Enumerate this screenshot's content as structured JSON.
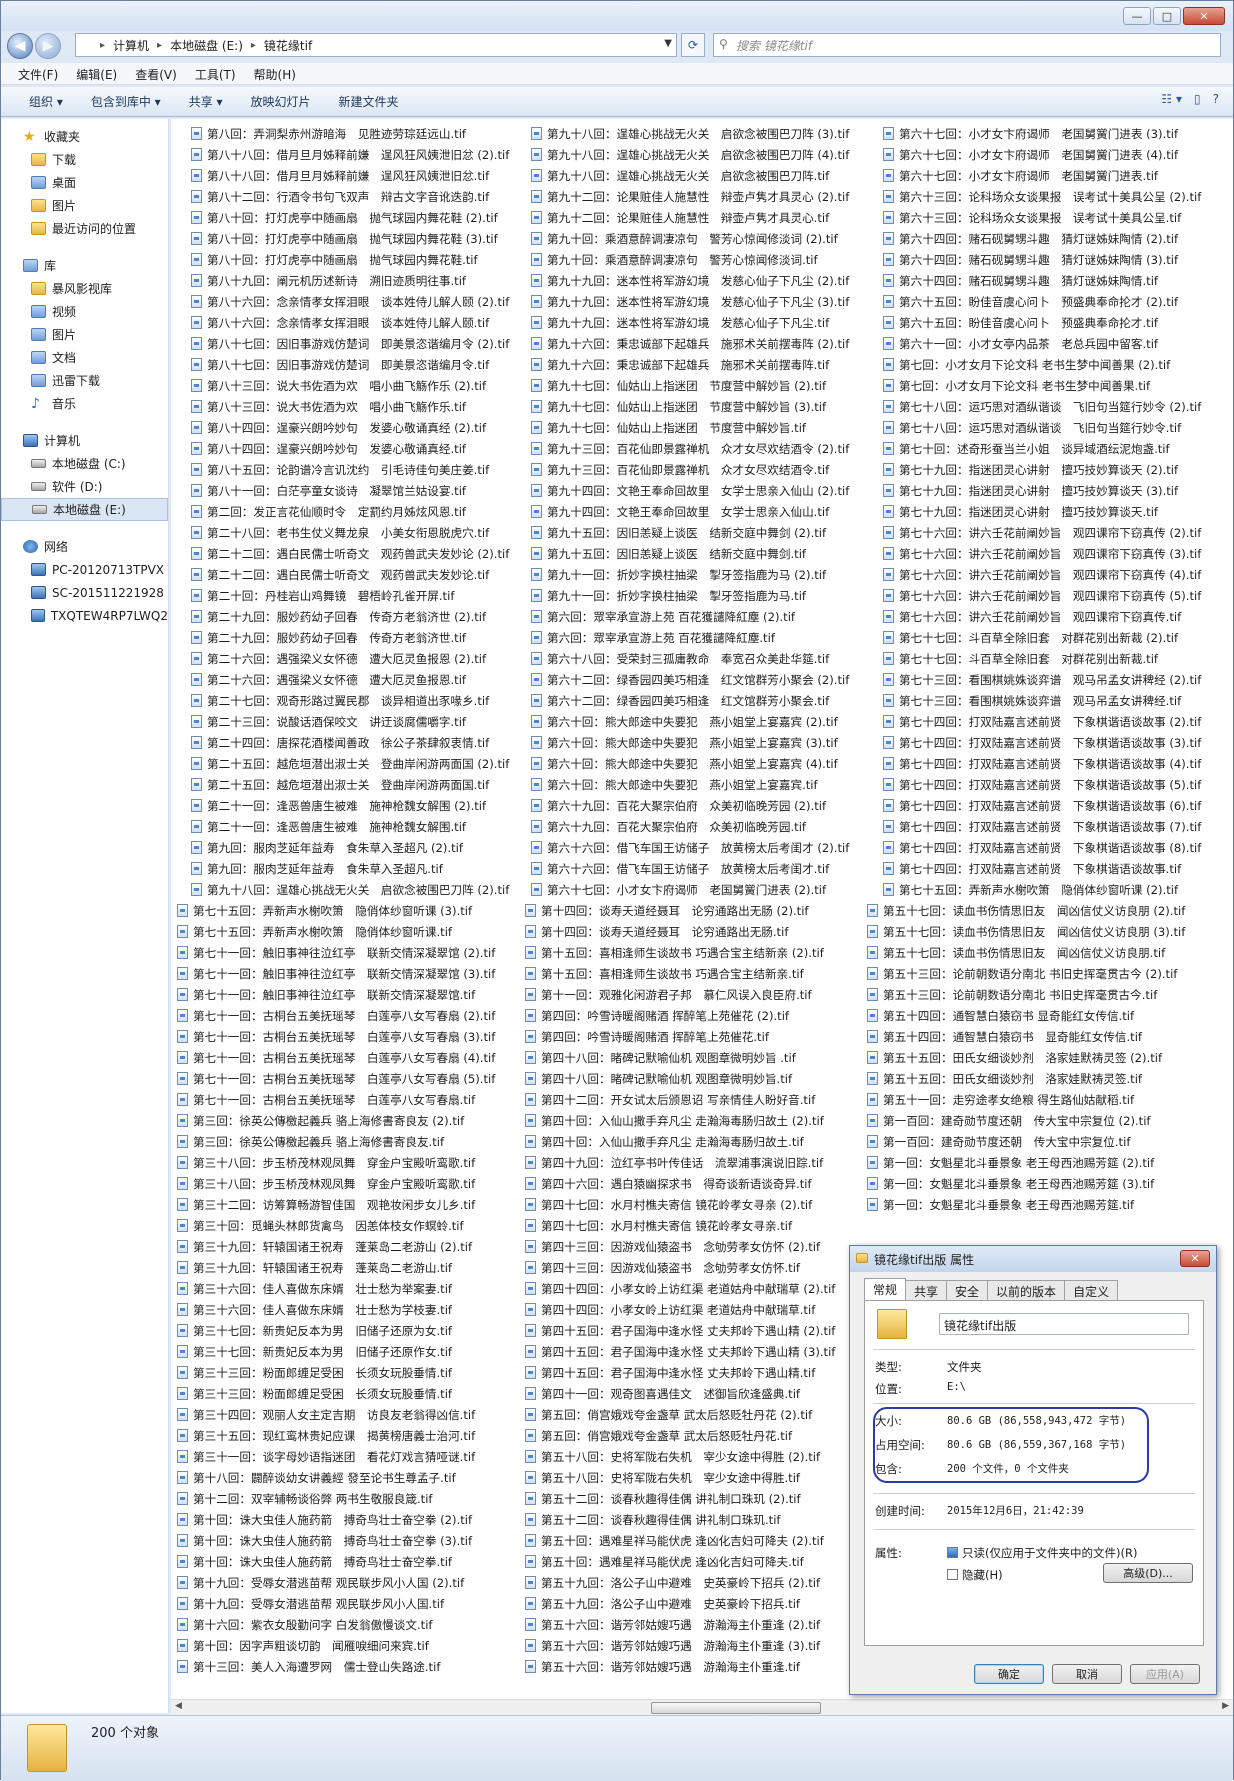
{
  "window": {
    "buttons": [
      "—",
      "□",
      "✕"
    ]
  },
  "nav": {
    "back": "◀",
    "forward": "▶",
    "path": [
      "计算机",
      "本地磁盘 (E:)",
      "镜花缘tif"
    ],
    "search_placeholder": "搜索 镜花缘tif"
  },
  "menu": [
    "文件(F)",
    "编辑(E)",
    "查看(V)",
    "工具(T)",
    "帮助(H)"
  ],
  "toolbar": [
    "组织 ▾",
    "包含到库中 ▾",
    "共享 ▾",
    "放映幻灯片",
    "新建文件夹"
  ],
  "sidebar": [
    {
      "label": "收藏夹",
      "icon": "star-icon",
      "hd": true,
      "gap": false
    },
    {
      "label": "下载",
      "icon": "folder-icon"
    },
    {
      "label": "桌面",
      "icon": "desktop-icon"
    },
    {
      "label": "图片",
      "icon": "folder-icon"
    },
    {
      "label": "最近访问的位置",
      "icon": "folder-icon"
    },
    {
      "label": "库",
      "icon": "library-icon",
      "hd": true,
      "gap": true
    },
    {
      "label": "暴风影视库",
      "icon": "folder-icon"
    },
    {
      "label": "视频",
      "icon": "library-icon"
    },
    {
      "label": "图片",
      "icon": "library-icon"
    },
    {
      "label": "文档",
      "icon": "library-icon"
    },
    {
      "label": "迅雷下载",
      "icon": "library-icon"
    },
    {
      "label": "音乐",
      "icon": "music-icon"
    },
    {
      "label": "计算机",
      "icon": "computer-icon",
      "hd": true,
      "gap": true
    },
    {
      "label": "本地磁盘 (C:)",
      "icon": "disk-icon"
    },
    {
      "label": "软件 (D:)",
      "icon": "disk-icon"
    },
    {
      "label": "本地磁盘 (E:)",
      "icon": "disk-icon",
      "sel": true
    },
    {
      "label": "网络",
      "icon": "network-icon",
      "hd": true,
      "gap": true
    },
    {
      "label": "PC-20120713TPVX",
      "icon": "computer-icon"
    },
    {
      "label": "SC-201511221928",
      "icon": "computer-icon"
    },
    {
      "label": "TXQTEW4RP7LWQ2",
      "icon": "computer-icon"
    }
  ],
  "columns": [
    [
      "第八回：弄洞梨赤州游暗海　见胜迹劳琮廷远山.tif",
      "第八十八回：借月旦月姊释前嫌　逞风狂风姨泄旧忿 (2).tif",
      "第八十八回：借月旦月姊释前嫌　逞风狂风姨泄旧忿.tif",
      "第八十二回：行酒令书句飞双声　辩古文字音讹迭韵.tif",
      "第八十回：打灯虎亭中随画扇　抛气球园内舞花鞋 (2).tif",
      "第八十回：打灯虎亭中随画扇　抛气球园内舞花鞋 (3).tif",
      "第八十回：打灯虎亭中随画扇　抛气球园内舞花鞋.tif",
      "第八十九回：阐元机历述新诗　溯旧迹质明往事.tif",
      "第八十六回：念亲情孝女挥泪眼　谈本姓侍儿解人颐 (2).tif",
      "第八十六回：念亲情孝女挥泪眼　谈本姓侍儿解人颐.tif",
      "第八十七回：因旧事游戏仿楚词　即美景恣谐编月令 (2).tif",
      "第八十七回：因旧事游戏仿楚词　即美景恣谐编月令.tif",
      "第八十三回：说大书佐酒为欢　唱小曲飞觞作乐 (2).tif",
      "第八十三回：说大书佐酒为欢　唱小曲飞觞作乐.tif",
      "第八十四回：逞豪兴朗吟妙句　发婆心敬诵真经 (2).tif",
      "第八十四回：逞豪兴朗吟妙句　发婆心敬诵真经.tif",
      "第八十五回：论韵谱冷言讥沈约　引毛诗佳句美庄姜.tif",
      "第八十一回：白茫亭童女谈诗　凝翠馆兰姑设宴.tif",
      "第二回：发正言花仙顺时令　定罰约月姊炫风恩.tif",
      "第二十八回：老书生仗义舞龙泉　小美女衔恩脱虎穴.tif",
      "第二十二回：遇白民儒士听奇文　观药兽武夫发妙论 (2).tif",
      "第二十二回：遇白民儒士听奇文　观药兽武夫发妙论.tif",
      "第二十回：丹桂岩山鸡舞镜　碧梧岭孔雀开屏.tif",
      "第二十九回：服妙药幼子回春　传奇方老翁济世 (2).tif",
      "第二十九回：服妙药幼子回春　传奇方老翁济世.tif",
      "第二十六回：遇强梁义女怀德　遭大厄灵鱼报恩 (2).tif",
      "第二十六回：遇强梁义女怀德　遭大厄灵鱼报恩.tif",
      "第二十七回：观奇形路过翼民郡　谈异相道出豕喙乡.tif",
      "第二十三回：说酸话酒保咬文　讲迂谈腐儒嚼字.tif",
      "第二十四回：唐探花酒楼闻善政　徐公子茶肆叙衷情.tif",
      "第二十五回：越危垣潜出淑士关　登曲岸闲游两面国 (2).tif",
      "第二十五回：越危垣潜出淑士关　登曲岸闲游两面国.tif",
      "第二十一回：逢恶兽唐生被难　施神枪魏女解围 (2).tif",
      "第二十一回：逢恶兽唐生被难　施神枪魏女解围.tif",
      "第九回：服肉芝延年益寿　食朱草入圣超凡 (2).tif",
      "第九回：服肉芝延年益寿　食朱草入圣超凡.tif",
      "第九十八回：逞雄心挑战无火关　启欲念被围巴刀阵 (2).tif"
    ],
    [
      "第九十八回：逞雄心挑战无火关　启欲念被围巴刀阵 (3).tif",
      "第九十八回：逞雄心挑战无火关　启欲念被围巴刀阵 (4).tif",
      "第九十八回：逞雄心挑战无火关　启欲念被围巴刀阵.tif",
      "第九十二回：论果赃佳人施慧性　辩壶卢隽才具灵心 (2).tif",
      "第九十二回：论果赃佳人施慧性　辩壶卢隽才具灵心.tif",
      "第九十回：乘酒意醉调凄凉句　警芳心惊闻修淡词 (2).tif",
      "第九十回：乘酒意醉调凄凉句　警芳心惊闻修淡词.tif",
      "第九十九回：迷本性将军游幻境　发慈心仙子下凡尘 (2).tif",
      "第九十九回：迷本性将军游幻境　发慈心仙子下凡尘 (3).tif",
      "第九十九回：迷本性将军游幻境　发慈心仙子下凡尘.tif",
      "第九十六回：秉忠诚部下起雄兵　施邪术关前摆毒阵 (2).tif",
      "第九十六回：秉忠诚部下起雄兵　施邪术关前摆毒阵.tif",
      "第九十七回：仙姑山上指迷团　节度营中解妙旨 (2).tif",
      "第九十七回：仙姑山上指迷团　节度营中解妙旨 (3).tif",
      "第九十七回：仙姑山上指迷团　节度营中解妙旨.tif",
      "第九十三回：百花仙即景露禅机　众才女尽欢结酒令 (2).tif",
      "第九十三回：百花仙即景露禅机　众才女尽欢结酒令.tif",
      "第九十四回：文艳王奉命回故里　女学士思亲入仙山 (2).tif",
      "第九十四回：文艳王奉命回故里　女学士思亲入仙山.tif",
      "第九十五回：因旧恙疑上谈医　结新交庭中舞剑 (2).tif",
      "第九十五回：因旧恙疑上谈医　结新交庭中舞剑.tif",
      "第九十一回：折妙字换柱抽梁　掣牙签指鹿为马 (2).tif",
      "第九十一回：折妙字换柱抽梁　掣牙签指鹿为马.tif",
      "第六回：眾宰承宣游上苑 百花獲譴降紅塵 (2).tif",
      "第六回：眾宰承宣游上苑 百花獲譴降紅塵.tif",
      "第六十八回：受荣封三孤庸教命　奉宽召众美赴华筵.tif",
      "第六十二回：绿香园四美巧相逢　红文馆群芳小聚会 (2).tif",
      "第六十二回：绿香园四美巧相逢　红文馆群芳小聚会.tif",
      "第六十回：熊大郎途中失要犯　燕小姐堂上宴嘉宾 (2).tif",
      "第六十回：熊大郎途中失要犯　燕小姐堂上宴嘉宾 (3).tif",
      "第六十回：熊大郎途中失要犯　燕小姐堂上宴嘉宾 (4).tif",
      "第六十回：熊大郎途中失要犯　燕小姐堂上宴嘉宾.tif",
      "第六十九回：百花大聚宗伯府　众美初临晚芳园 (2).tif",
      "第六十九回：百花大聚宗伯府　众美初临晚芳园.tif",
      "第六十六回：借飞车国王访储子　放黄榜太后考闺才 (2).tif",
      "第六十六回：借飞车国王访储子　放黄榜太后考闺才.tif",
      "第六十七回：小才女卞府谒师　老国舅黉门进表 (2).tif"
    ],
    [
      "第六十七回：小才女卞府谒师　老国舅黉门进表 (3).tif",
      "第六十七回：小才女卞府谒师　老国舅黉门进表 (4).tif",
      "第六十七回：小才女卞府谒师　老国舅黉门进表.tif",
      "第六十三回：论科场众女谈果报　误考试十美具公呈 (2).tif",
      "第六十三回：论科场众女谈果报　误考试十美具公呈.tif",
      "第六十四回：赌石砚舅甥斗趣　猜灯谜姊妹陶情 (2).tif",
      "第六十四回：赌石砚舅甥斗趣　猜灯谜姊妹陶情 (3).tif",
      "第六十四回：赌石砚舅甥斗趣　猜灯谜姊妹陶情.tif",
      "第六十五回：盼佳音虞心问卜　预盛典奉命抡才 (2).tif",
      "第六十五回：盼佳音虞心问卜　预盛典奉命抡才.tif",
      "第六十一回：小才女亭内品茶　老总兵园中留客.tif",
      "第七回：小才女月下论文科 老书生梦中闻善果 (2).tif",
      "第七回：小才女月下论文科 老书生梦中闻善果.tif",
      "第七十八回：运巧思对酒纵谐谈　飞旧句当筵行妙令 (2).tif",
      "第七十八回：运巧思对酒纵谐谈　飞旧句当筵行妙令.tif",
      "第七十回：述奇形蚕当兰小姐　谈异域酒纭泥炮盏.tif",
      "第七十九回：指迷团灵心讲射　擅巧技妙算谈天 (2).tif",
      "第七十九回：指迷团灵心讲射　擅巧技妙算谈天 (3).tif",
      "第七十九回：指迷团灵心讲射　擅巧技妙算谈天.tif",
      "第七十六回：讲六壬花前阐妙旨　观四课帘下窃真传 (2).tif",
      "第七十六回：讲六壬花前阐妙旨　观四课帘下窃真传 (3).tif",
      "第七十六回：讲六壬花前阐妙旨　观四课帘下窃真传 (4).tif",
      "第七十六回：讲六壬花前阐妙旨　观四课帘下窃真传 (5).tif",
      "第七十六回：讲六壬花前阐妙旨　观四课帘下窃真传.tif",
      "第七十七回：斗百草全除旧套　对群花别出新裁 (2).tif",
      "第七十七回：斗百草全除旧套　对群花别出新裁.tif",
      "第七十三回：看围棋姚姝谈弈谱　观马吊孟女讲稗经 (2).tif",
      "第七十三回：看围棋姚姝谈弈谱　观马吊孟女讲稗经.tif",
      "第七十四回：打双陆嘉言述前贤　下象棋谐语谈故事 (2).tif",
      "第七十四回：打双陆嘉言述前贤　下象棋谐语谈故事 (3).tif",
      "第七十四回：打双陆嘉言述前贤　下象棋谐语谈故事 (4).tif",
      "第七十四回：打双陆嘉言述前贤　下象棋谐语谈故事 (5).tif",
      "第七十四回：打双陆嘉言述前贤　下象棋谐语谈故事 (6).tif",
      "第七十四回：打双陆嘉言述前贤　下象棋谐语谈故事 (7).tif",
      "第七十四回：打双陆嘉言述前贤　下象棋谐语谈故事 (8).tif",
      "第七十四回：打双陆嘉言述前贤　下象棋谐语谈故事.tif",
      "第七十五回：弄新声水榭吹箫　隐俏体纱窗听课 (2).tif"
    ],
    [
      "第七十五回：弄新声水榭吹箫　隐俏体纱窗听课 (3).tif",
      "第七十五回：弄新声水榭吹箫　隐俏体纱窗听课.tif",
      "第七十一回：触旧事神往泣红亭　联新交情深凝翠馆 (2).tif",
      "第七十一回：触旧事神往泣红亭　联新交情深凝翠馆 (3).tif",
      "第七十一回：触旧事神往泣红亭　联新交情深凝翠馆.tif",
      "第七十一回：古桐台五美抚瑶琴　白莲亭八女写春扇 (2).tif",
      "第七十一回：古桐台五美抚瑶琴　白莲亭八女写春扇 (3).tif",
      "第七十一回：古桐台五美抚瑶琴　白莲亭八女写春扇 (4).tif",
      "第七十一回：古桐台五美抚瑶琴　白莲亭八女写春扇 (5).tif",
      "第七十一回：古桐台五美抚瑶琴　白莲亭八女写春扇.tif",
      "第三回：徐英公傳檄起義兵 骆上海修書寄良友 (2).tif",
      "第三回：徐英公傳檄起義兵 骆上海修書寄良友.tif",
      "第三十八回：步玉桥茂林观凤舞　穿金户宝殿听鸾歌.tif",
      "第三十八回：步玉桥茂林观凤舞　穿金户宝殿听鸾歌.tif",
      "第三十二回：访筹算畅游智佳国　观艳妆闲步女儿乡.tif",
      "第三十回：觅蝇头林郎货禽鸟　因恙体枝女作螟蛉.tif",
      "第三十九回：轩辕国诸王祝寿　蓬莱岛二老游山 (2).tif",
      "第三十九回：轩辕国诸王祝寿　蓬莱岛二老游山.tif",
      "第三十六回：佳人喜做东床婿　壮士愁为举案妻.tif",
      "第三十六回：佳人喜做东床婿　壮士愁为学枝妻.tif",
      "第三十七回：新贵妃反本为男　旧储子还原为女.tif",
      "第三十七回：新贵妃反本为男　旧储子还原作女.tif",
      "第三十三回：粉面郎缠足受困　长须女玩股垂情.tif",
      "第三十三回：粉面郎缠足受困　长须女玩股垂情.tif",
      "第三十四回：观丽人女主定吉期　访良友老翁得凶信.tif",
      "第三十五回：现红鸾林贵妃应课　揭黄榜唐義士治河.tif",
      "第三十一回：谈字母妙语指迷团　看花灯戏言猜哑谜.tif",
      "第十八回：闢醉谈幼女讲義經 發至论书生尊孟子.tif",
      "第十二回：双宰辅畅谈俗弊 两书生敬服良箴.tif",
      "第十回：诛大虫佳人施药箭　搏奇鸟壮士奋空拳 (2).tif",
      "第十回：诛大虫佳人施药箭　搏奇鸟壮士奋空拳 (3).tif",
      "第十回：诛大虫佳人施药箭　搏奇鸟壮士奋空拳.tif",
      "第十九回：受辱女潜逃苗帮 观民联步风小人国 (2).tif",
      "第十九回：受辱女潜逃苗帮 观民联步风小人国.tif",
      "第十六回：紫衣女殷勤问字 白发翁傲慢谈文.tif",
      "第十回：因字声粗谈切韵　闻雁唳细问来宾.tif",
      "第十三回：美人入海遭罗网　儒士登山失路途.tif"
    ],
    [
      "第十四回：谈寿夭道经聂耳　论穷通路出无肠 (2).tif",
      "第十四回：谈寿夭道经聂耳　论穷通路出无肠.tif",
      "第十五回：喜相逢师生谈故书 巧遇合宝主结新亲 (2).tif",
      "第十五回：喜相逢师生谈故书 巧遇合宝主结新亲.tif",
      "第十一回：观雅化闲游君子邦　慕仁风误入良臣府.tif",
      "第四回：吟雪诗暖阁赌酒 挥醉笔上苑催花 (2).tif",
      "第四回：吟雪诗暖阁赌酒 挥醉笔上苑催花.tif",
      "第四十八回：睹碑记默喻仙机 观图章微明妙旨 .tif",
      "第四十八回：睹碑记默喻仙机 观图章微明妙旨.tif",
      "第四十二回：开女试太后颁恩诏 写亲情佳人盼好音.tif",
      "第四十回：入仙山撒手弃凡尘 走瀚海毒肠归故土 (2).tif",
      "第四十回：入仙山撒手弃凡尘 走瀚海毒肠归故土.tif",
      "第四十九回：泣红亭书叶传佳话　流翠浦事演说旧踪.tif",
      "第四十六回：遇白猿幽探求书　得奇谈新语谈奇异.tif",
      "第四十七回：水月村樵夫寄信 镜花岭孝女寻亲 (2).tif",
      "第四十七回：水月村樵夫寄信 镜花岭孝女寻亲.tif",
      "第四十三回：因游戏仙猿盗书　念劬劳孝女仿怀 (2).tif",
      "第四十三回：因游戏仙猿盗书　念劬劳孝女仿怀.tif",
      "第四十四回：小孝女岭上访红渠 老道姑舟中献瑞草 (2).tif",
      "第四十四回：小孝女岭上访红渠 老道姑舟中献瑞草.tif",
      "第四十五回：君子国海中逢水怪 丈夫邦岭下遇山精 (2).tif",
      "第四十五回：君子国海中逢水怪 丈夫邦岭下遇山精 (3).tif",
      "第四十五回：君子国海中逢水怪 丈夫邦岭下遇山精.tif",
      "第四十一回：观奇图喜遇佳文　述御旨欣逢盛典.tif",
      "第五回：俏宫娥戏夸金盏草 武太后怒贬牡丹花 (2).tif",
      "第五回：俏宫娥戏夸金盏草 武太后怒贬牡丹花.tif",
      "第五十八回：史将军陇右失机　宰少女途中得胜 (2).tif",
      "第五十八回：史将军陇右失机　宰少女途中得胜.tif",
      "第五十二回：谈春秋趣得佳偶 讲礼制口珠玑 (2).tif",
      "第五十二回：谈春秋趣得佳偶 讲礼制口珠玑.tif",
      "第五十回：遇难星祥马能伏虎 逢凶化吉妇可降夫 (2).tif",
      "第五十回：遇难星祥马能伏虎 逢凶化吉妇可降夫.tif",
      "第五十九回：洛公子山中避难　史英豪岭下招兵 (2).tif",
      "第五十九回：洛公子山中避难　史英豪岭下招兵.tif",
      "第五十六回：谐芳邻姑嫂巧遇　游瀚海主仆重逢 (2).tif",
      "第五十六回：谐芳邻姑嫂巧遇　游瀚海主仆重逢 (3).tif",
      "第五十六回：谐芳邻姑嫂巧遇　游瀚海主仆重逢.tif"
    ],
    [
      "第五十七回：读血书伤情思旧友　闻凶信仗义访良朋 (2).tif",
      "第五十七回：读血书伤情思旧友　闻凶信仗义访良朋 (3).tif",
      "第五十七回：读血书伤情思旧友　闻凶信仗义访良朋.tif",
      "第五十三回：论前朝数语分南北 书旧史挥毫贯古今 (2).tif",
      "第五十三回：论前朝数语分南北 书旧史挥毫贯古今.tif",
      "第五十四回：通智慧白猿窃书 显奇能红女传信.tif",
      "第五十四回：通智慧白猿窃书　显奇能红女传信.tif",
      "第五十五回：田氏女细谈妙剂　洛家娃默祷灵签 (2).tif",
      "第五十五回：田氏女细谈妙剂　洛家娃默祷灵签.tif",
      "第五十一回：走穷途孝女绝粮 得生路仙姑献稻.tif",
      "第一百回：建奇勋节度还朝　传大宝中宗复位 (2).tif",
      "第一百回：建奇勋节度还朝　传大宝中宗复位.tif",
      "第一回：女魁星北斗垂景象 老王母西池赐芳筵 (2).tif",
      "第一回：女魁星北斗垂景象 老王母西池赐芳筵 (3).tif",
      "第一回：女魁星北斗垂景象 老王母西池赐芳筵.tif"
    ]
  ],
  "status": {
    "count": "200 个对象"
  },
  "dialog": {
    "title": "镜花缘tif出版 属性",
    "close": "✕",
    "tabs": [
      "常规",
      "共享",
      "安全",
      "以前的版本",
      "自定义"
    ],
    "name": "镜花缘tif出版",
    "type_k": "类型:",
    "type_v": "文件夹",
    "loc_k": "位置:",
    "loc_v": "E:\\",
    "size_k": "大小:",
    "size_v": "80.6 GB (86,558,943,472 字节)",
    "disk_k": "占用空间:",
    "disk_v": "80.6 GB (86,559,367,168 字节)",
    "contains_k": "包含:",
    "contains_v": "200 个文件，0 个文件夹",
    "created_k": "创建时间:",
    "created_v": "2015年12月6日，21:42:39",
    "attr_k": "属性:",
    "readonly": "只读(仅应用于文件夹中的文件)(R)",
    "hidden": "隐藏(H)",
    "advanced": "高级(D)...",
    "ok": "确定",
    "cancel": "取消",
    "apply": "应用(A)"
  }
}
